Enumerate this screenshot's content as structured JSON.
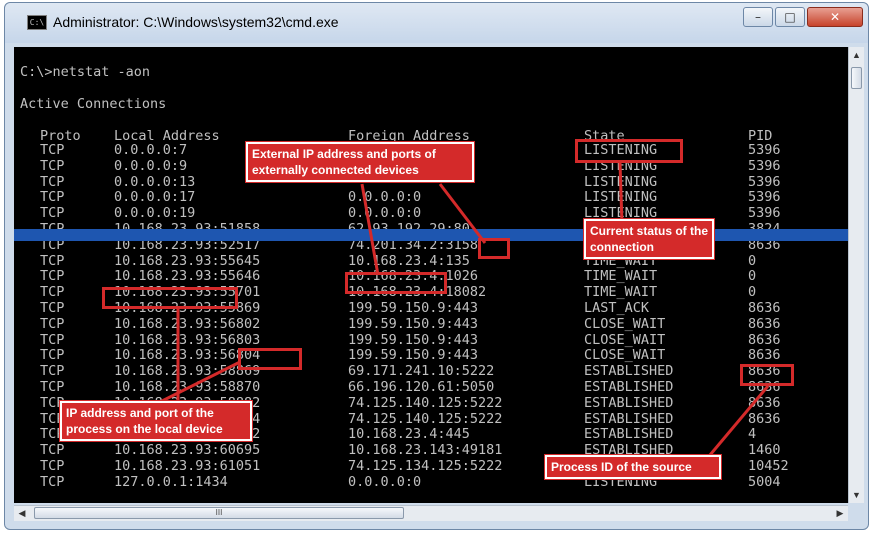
{
  "window": {
    "title": "Administrator: C:\\Windows\\system32\\cmd.exe",
    "icon": "cmd-icon",
    "controls": {
      "minimize": "–",
      "maximize": "□",
      "close": "✕"
    }
  },
  "console": {
    "prompt": "C:\\>netstat -aon",
    "heading": "Active Connections",
    "columns": {
      "proto": "Proto",
      "local": "Local Address",
      "foreign": "Foreign Address",
      "state": "State",
      "pid": "PID"
    },
    "rows": [
      {
        "proto": "TCP",
        "local": "0.0.0.0:7",
        "foreign": "",
        "state": "LISTENING",
        "pid": "5396"
      },
      {
        "proto": "TCP",
        "local": "0.0.0.0:9",
        "foreign": "",
        "state": "LISTENING",
        "pid": "5396"
      },
      {
        "proto": "TCP",
        "local": "0.0.0.0:13",
        "foreign": "",
        "state": "LISTENING",
        "pid": "5396"
      },
      {
        "proto": "TCP",
        "local": "0.0.0.0:17",
        "foreign": "0.0.0.0:0",
        "state": "LISTENING",
        "pid": "5396"
      },
      {
        "proto": "TCP",
        "local": "0.0.0.0:19",
        "foreign": "0.0.0.0:0",
        "state": "LISTENING",
        "pid": "5396"
      },
      {
        "proto": "TCP",
        "local": "10.168.23.93:51858",
        "foreign": "62.93.192.29:80",
        "state": "",
        "pid": "3824"
      },
      {
        "proto": "TCP",
        "local": "10.168.23.93:52517",
        "foreign": "74.201.34.2:3158",
        "state": "ESTABLISHED",
        "pid": "8636"
      },
      {
        "proto": "TCP",
        "local": "10.168.23.93:55645",
        "foreign": "10.168.23.4:135",
        "state": "TIME_WAIT",
        "pid": "0"
      },
      {
        "proto": "TCP",
        "local": "10.168.23.93:55646",
        "foreign": "10.168.23.4:1026",
        "state": "TIME_WAIT",
        "pid": "0"
      },
      {
        "proto": "TCP",
        "local": "10.168.23.93:55701",
        "foreign": "10.168.23.4:18082",
        "state": "TIME_WAIT",
        "pid": "0"
      },
      {
        "proto": "TCP",
        "local": "10.168.23.93:55869",
        "foreign": "199.59.150.9:443",
        "state": "LAST_ACK",
        "pid": "8636"
      },
      {
        "proto": "TCP",
        "local": "10.168.23.93:56802",
        "foreign": "199.59.150.9:443",
        "state": "CLOSE_WAIT",
        "pid": "8636"
      },
      {
        "proto": "TCP",
        "local": "10.168.23.93:56803",
        "foreign": "199.59.150.9:443",
        "state": "CLOSE_WAIT",
        "pid": "8636"
      },
      {
        "proto": "TCP",
        "local": "10.168.23.93:56804",
        "foreign": "199.59.150.9:443",
        "state": "CLOSE_WAIT",
        "pid": "8636"
      },
      {
        "proto": "TCP",
        "local": "10.168.23.93:58869",
        "foreign": "69.171.241.10:5222",
        "state": "ESTABLISHED",
        "pid": "8636"
      },
      {
        "proto": "TCP",
        "local": "10.168.23.93:58870",
        "foreign": "66.196.120.61:5050",
        "state": "ESTABLISHED",
        "pid": "8636"
      },
      {
        "proto": "TCP",
        "local": "10.168.23.93:58882",
        "foreign": "74.125.140.125:5222",
        "state": "ESTABLISHED",
        "pid": "8636"
      },
      {
        "proto": "TCP",
        "local": "10.168.23.93:58884",
        "foreign": "74.125.140.125:5222",
        "state": "ESTABLISHED",
        "pid": "8636"
      },
      {
        "proto": "TCP",
        "local": "10.168.23.93:59212",
        "foreign": "10.168.23.4:445",
        "state": "ESTABLISHED",
        "pid": "4"
      },
      {
        "proto": "TCP",
        "local": "10.168.23.93:60695",
        "foreign": "10.168.23.143:49181",
        "state": "ESTABLISHED",
        "pid": "1460"
      },
      {
        "proto": "TCP",
        "local": "10.168.23.93:61051",
        "foreign": "74.125.134.125:5222",
        "state": "ESTABLISHED",
        "pid": "10452"
      },
      {
        "proto": "TCP",
        "local": "127.0.0.1:1434",
        "foreign": "0.0.0.0:0",
        "state": "LISTENING",
        "pid": "5004"
      }
    ]
  },
  "annotations": {
    "foreign": "External IP address and ports of externally connected devices",
    "state": "Current status of the connection",
    "local": "IP address and port of the process on the local device",
    "pid": "Process ID of the source"
  },
  "scrollbar": {
    "grip": "III"
  },
  "colors": {
    "console_bg": "#000000",
    "console_text": "#c0c0c0",
    "annotation": "#d42a2a",
    "band": "#1e56b0"
  }
}
